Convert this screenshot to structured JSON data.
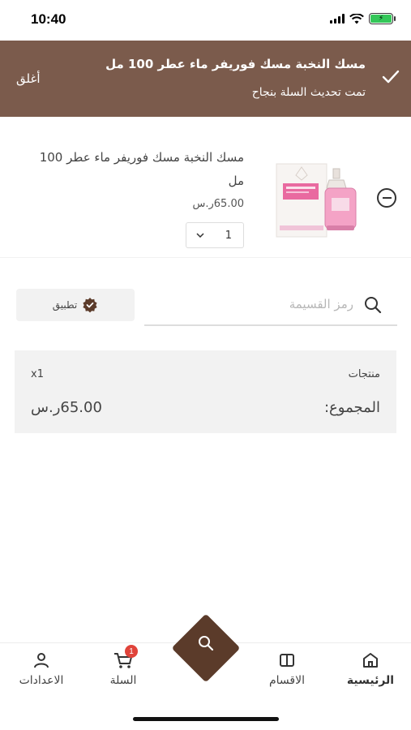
{
  "status_bar": {
    "time": "10:40",
    "battery": "⚡"
  },
  "banner": {
    "title": "مسك النخبة مسك فوريفر ماء عطر 100 مل",
    "subtitle": "تمت تحديث السلة بنجاح",
    "close_label": "أغلق",
    "bg_color": "#7b5b4c"
  },
  "cart_item": {
    "name": "مسك النخبة مسك فوريفر ماء عطر 100 مل",
    "price": "65.00ر.س",
    "quantity": "1"
  },
  "coupon": {
    "placeholder": "رمز القسيمة",
    "apply_label": "تطبيق"
  },
  "summary": {
    "products_label": "منتجات",
    "products_count": "x1",
    "total_label": "المجموع:",
    "total_value": "65.00ر.س"
  },
  "bottom_nav": {
    "items": [
      {
        "label": "الرئيسية",
        "icon": "home-icon",
        "active": true
      },
      {
        "label": "الاقسام",
        "icon": "categories-icon",
        "active": false
      },
      {
        "label": "السلة",
        "icon": "cart-icon",
        "active": false,
        "badge": "1"
      },
      {
        "label": "الاعدادات",
        "icon": "user-icon",
        "active": false
      }
    ],
    "fab_icon": "search-icon",
    "fab_color": "#5b3b2a"
  }
}
